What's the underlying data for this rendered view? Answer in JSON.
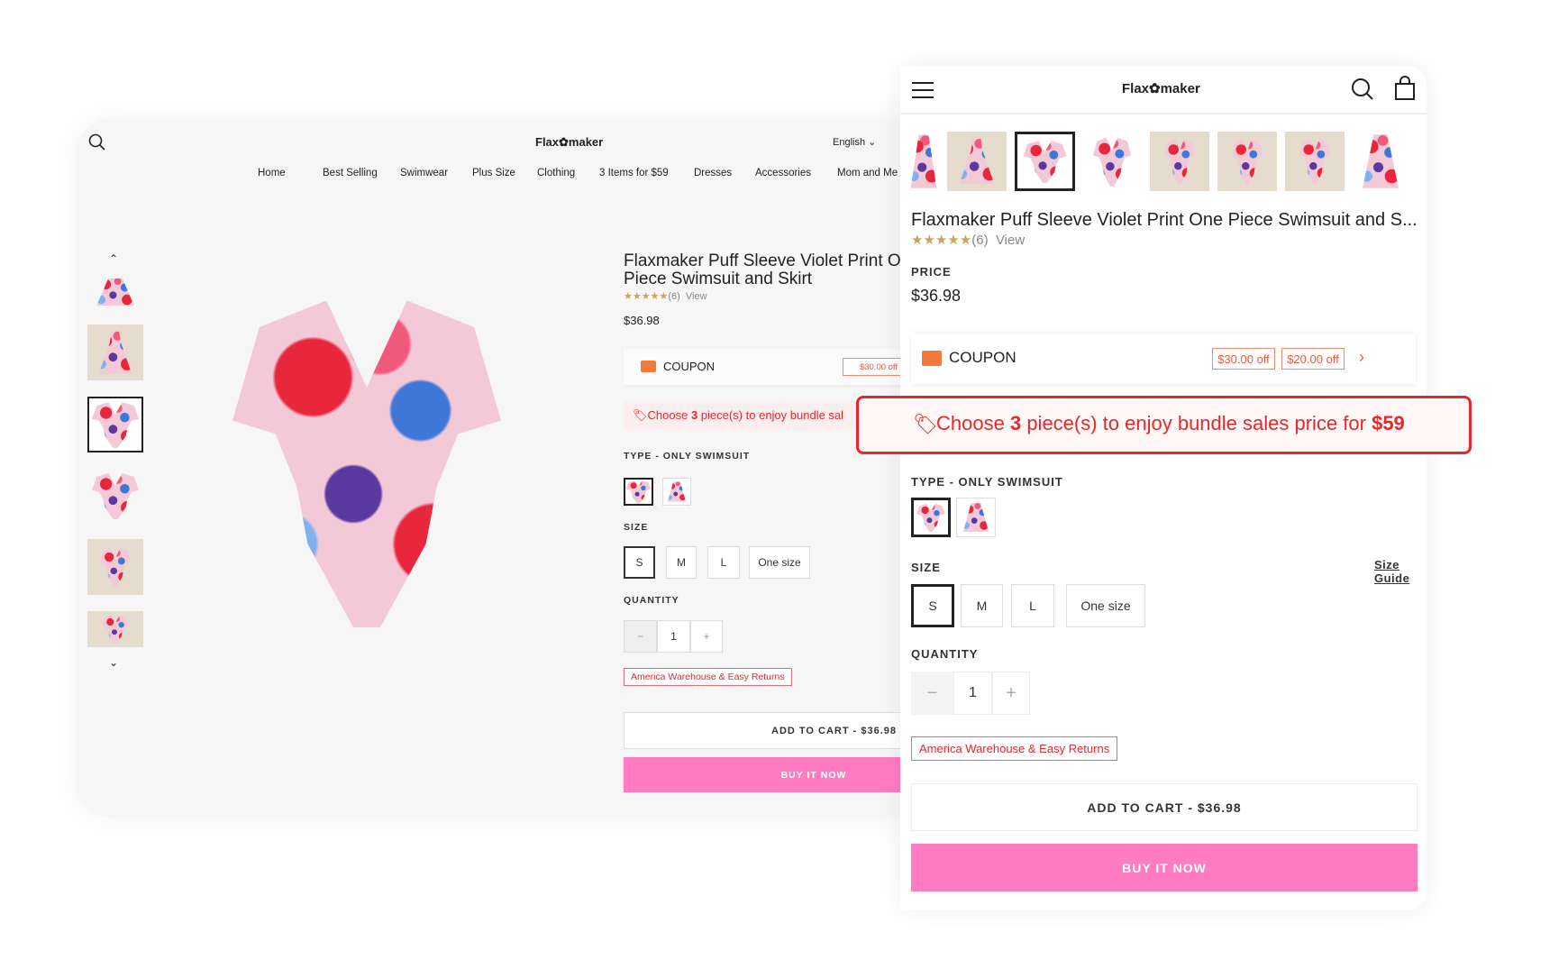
{
  "brand": "Flax✿maker",
  "desktop": {
    "language": "English",
    "nav": [
      "Home",
      "Best Selling",
      "Swimwear",
      "Plus Size",
      "Clothing",
      "3 Items for $59",
      "Dresses",
      "Accessories",
      "Mom and Me"
    ],
    "title": "Flaxmaker Puff Sleeve Violet Print One Piece Swimsuit and Skirt",
    "rating_count": "(6)",
    "view": "View",
    "price": "$36.98",
    "coupon": "COUPON",
    "coupon_tag": "$30.00 off",
    "bundle": {
      "pre": "Choose ",
      "num": "3",
      "post": " piece(s) to enjoy bundle sal"
    },
    "type_label": "TYPE - ONLY SWIMSUIT",
    "size_label": "SIZE",
    "sizes": [
      "S",
      "M",
      "L",
      "One size"
    ],
    "selected_size": "S",
    "quantity_label": "QUANTITY",
    "quantity": "1",
    "minus": "−",
    "plus": "+",
    "warehouse": "America Warehouse & Easy Returns",
    "add_to_cart": "ADD TO CART - $36.98",
    "buy_now": "BUY IT NOW"
  },
  "mobile": {
    "title": "Flaxmaker Puff Sleeve Violet Print One Piece Swimsuit and S...",
    "rating_count": "(6)",
    "view": "View",
    "price_label": "PRICE",
    "price": "$36.98",
    "coupon": "COUPON",
    "coupon_tags": [
      "$30.00 off",
      "$20.00 off"
    ],
    "bundle": {
      "pre": "Choose ",
      "num": "3",
      "mid": " piece(s) to enjoy bundle sales price for ",
      "price": "$59"
    },
    "type_label": "TYPE - ONLY SWIMSUIT",
    "size_label": "SIZE",
    "size_guide": "Size Guide",
    "sizes": [
      "S",
      "M",
      "L",
      "One size"
    ],
    "quantity_label": "QUANTITY",
    "quantity": "1",
    "minus": "−",
    "plus": "+",
    "warehouse": "America Warehouse & Easy Returns",
    "add_to_cart": "ADD TO CART - $36.98",
    "buy_now": "BUY IT NOW"
  },
  "rating": 5,
  "colors": {
    "accent_pink": "#ff7bc2",
    "alert_red": "#e8262c",
    "star": "#c9a45c"
  }
}
